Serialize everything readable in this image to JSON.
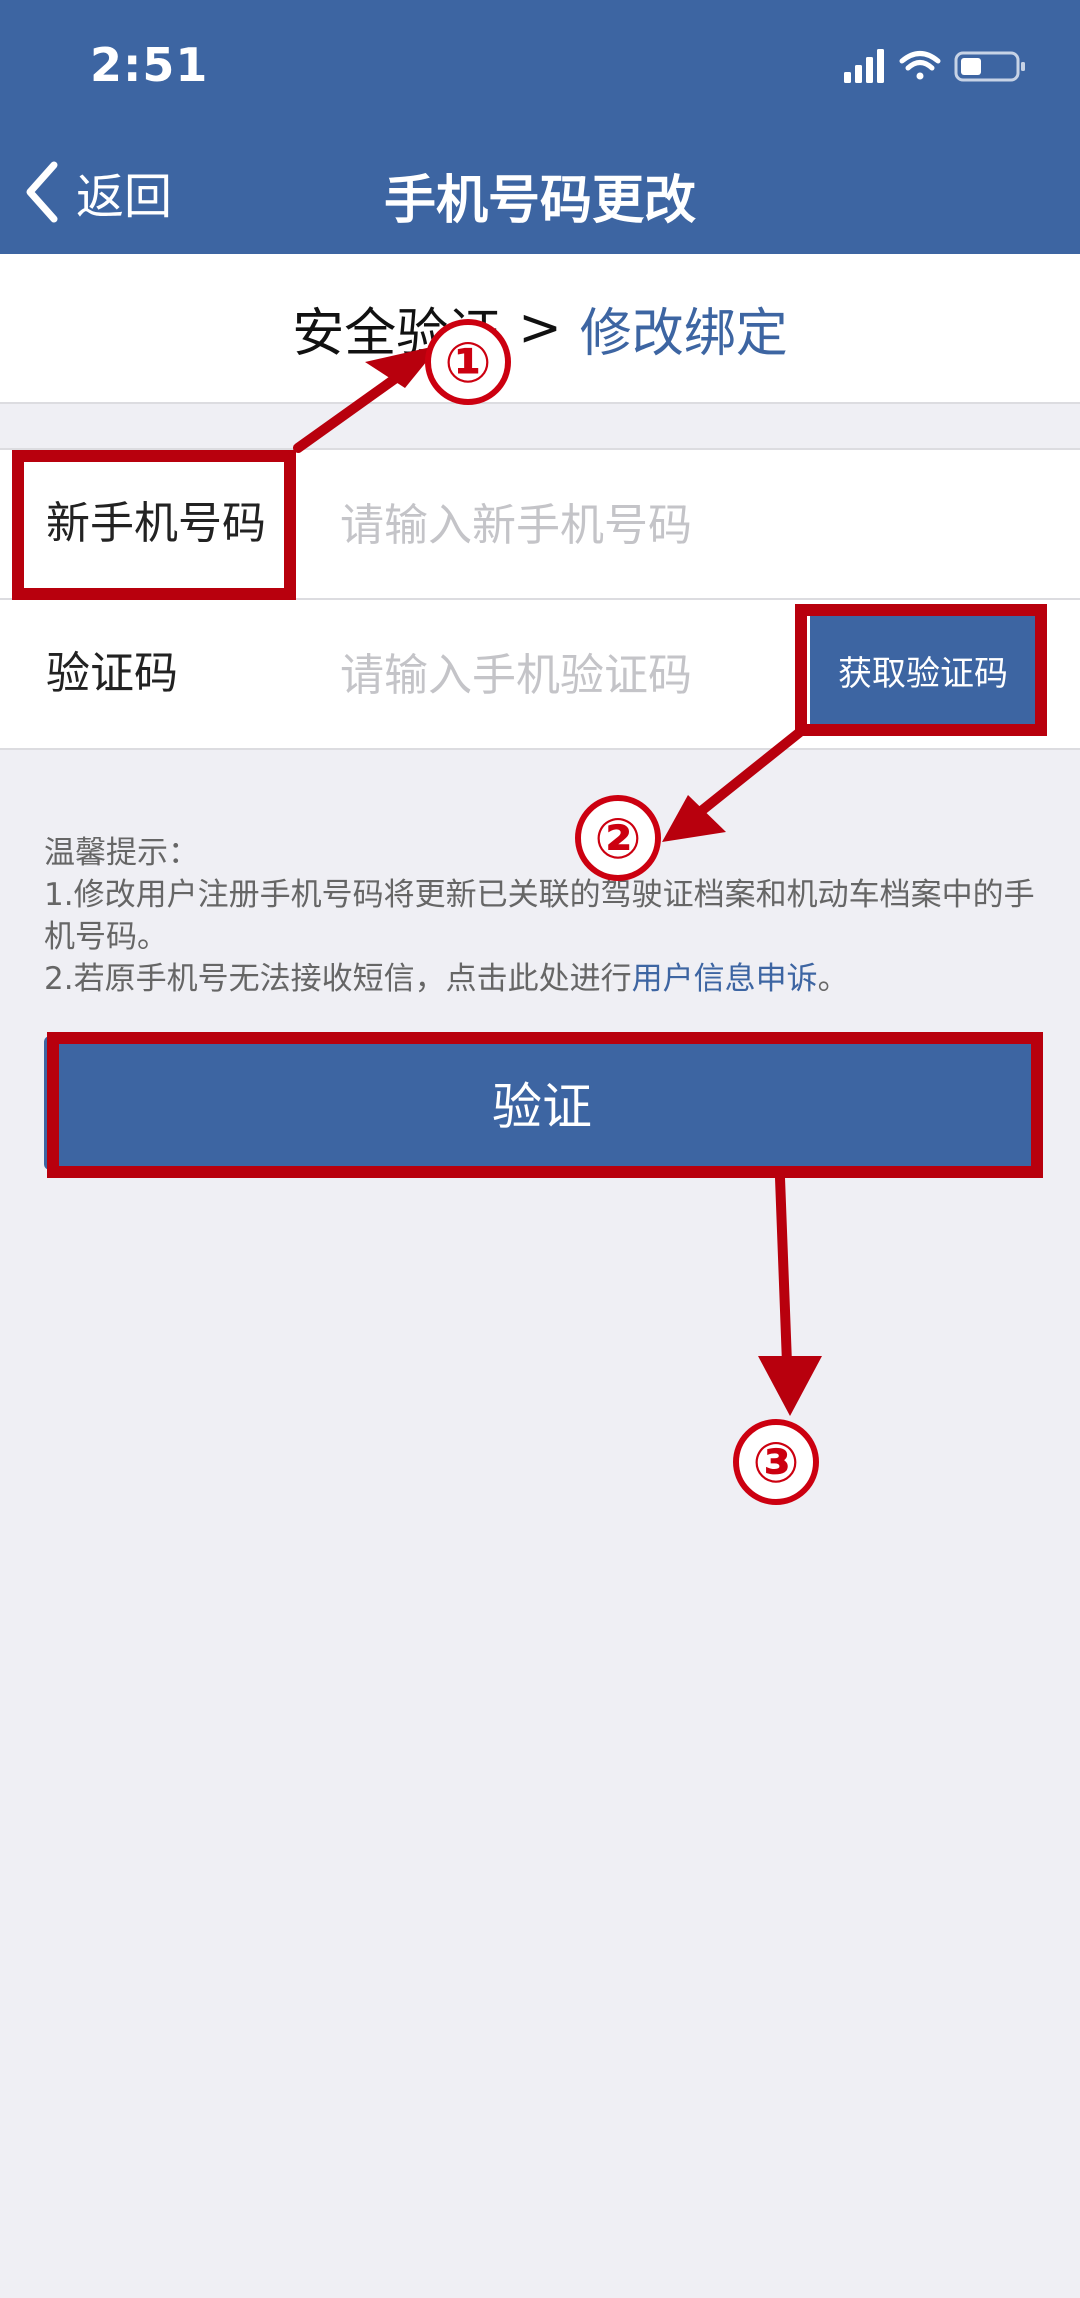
{
  "status_bar": {
    "time": "2:51",
    "icons": [
      "signal-icon",
      "wifi-icon",
      "battery-icon"
    ]
  },
  "nav": {
    "back_label": "返回",
    "title": "手机号码更改",
    "back_icon": "chevron-left-icon"
  },
  "steps": {
    "completed": "安全验证",
    "separator": ">",
    "current": "修改绑定"
  },
  "form": {
    "phone": {
      "label": "新手机号码",
      "placeholder": "请输入新手机号码",
      "value": ""
    },
    "code": {
      "label": "验证码",
      "placeholder": "请输入手机验证码",
      "value": "",
      "button": "获取验证码"
    }
  },
  "tips": {
    "title": "温馨提示：",
    "line1": "1.修改用户注册手机号码将更新已关联的驾驶证档案和机动车档案中的手机号码。",
    "line2_prefix": "2.若原手机号无法接收短信，点击此处进行",
    "line2_link": "用户信息申诉",
    "line2_suffix": "。"
  },
  "verify_button": "验证",
  "annotations": {
    "step1": "①",
    "step2": "②",
    "step3": "③"
  },
  "colors": {
    "primary": "#3d65a2",
    "background": "#efeff4",
    "annotation_red": "#b8000d"
  }
}
